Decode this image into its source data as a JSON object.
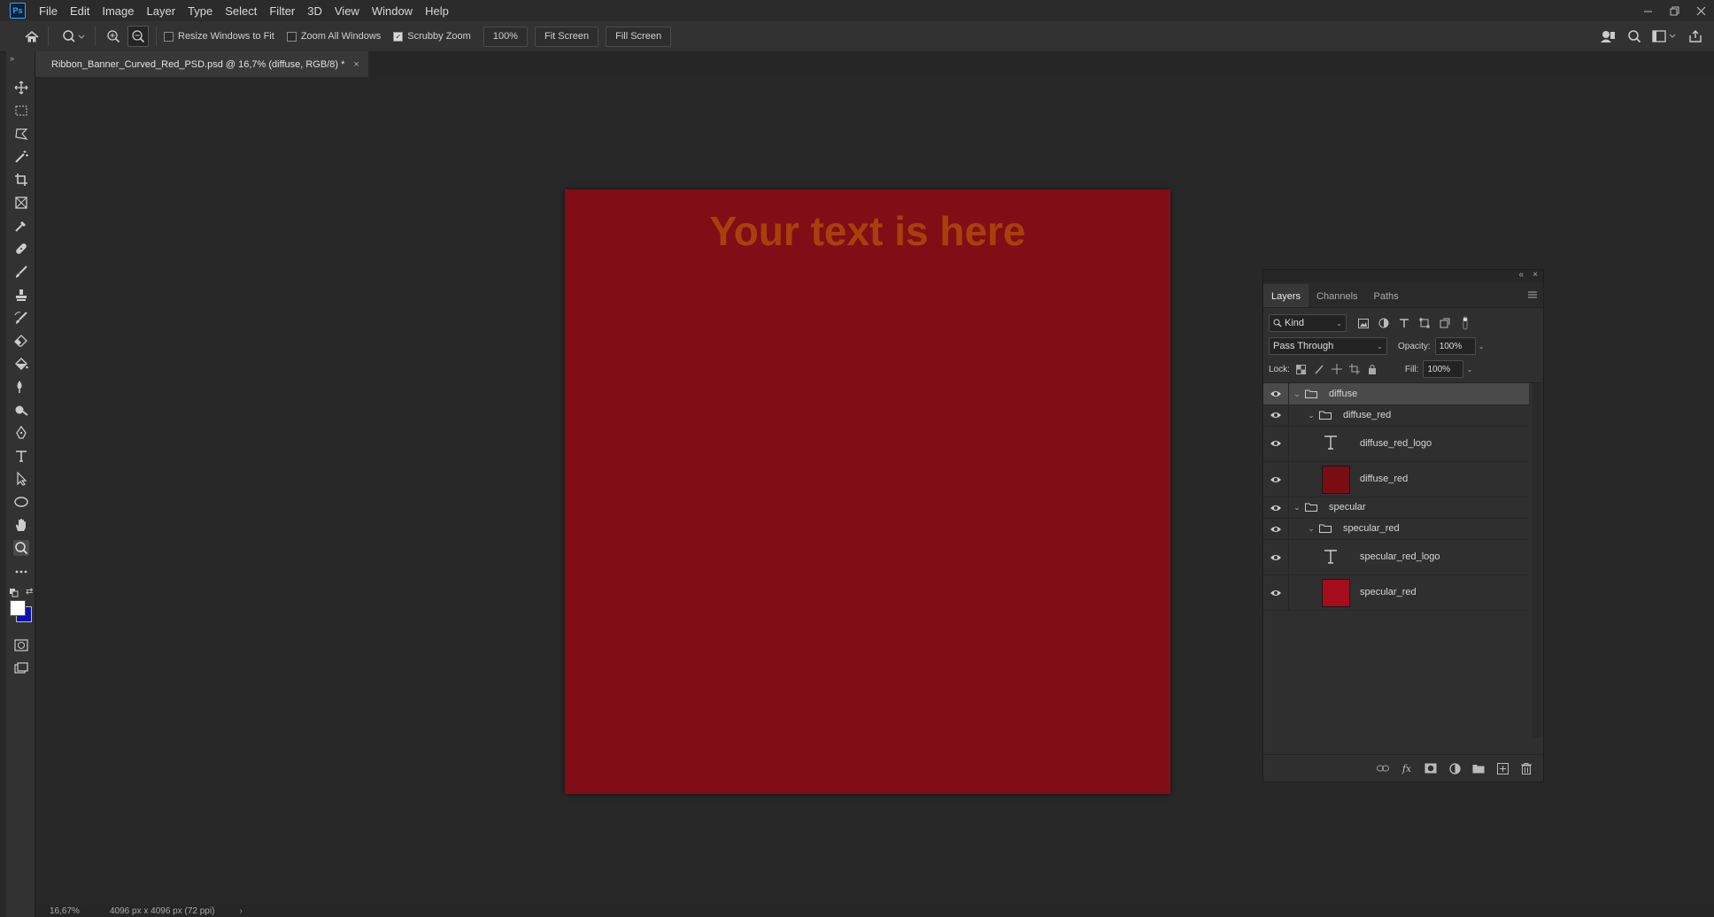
{
  "menu": {
    "logo": "Ps",
    "items": [
      "File",
      "Edit",
      "Image",
      "Layer",
      "Type",
      "Select",
      "Filter",
      "3D",
      "View",
      "Window",
      "Help"
    ]
  },
  "options": {
    "resize_windows": "Resize Windows to Fit",
    "resize_windows_checked": false,
    "zoom_all": "Zoom All Windows",
    "zoom_all_checked": false,
    "scrubby_zoom": "Scrubby Zoom",
    "scrubby_zoom_checked": true,
    "zoom_value": "100%",
    "fit_screen": "Fit Screen",
    "fill_screen": "Fill Screen"
  },
  "document": {
    "tab_title": "Ribbon_Banner_Curved_Red_PSD.psd @ 16,7% (diffuse, RGB/8) *",
    "canvas_text": "Your text is here",
    "canvas_color": "#810d16",
    "text_color": "#a8400c"
  },
  "status": {
    "zoom": "16,67%",
    "doc_size": "4096 px x 4096 px (72 ppi)"
  },
  "layers_panel": {
    "tabs": [
      "Layers",
      "Channels",
      "Paths"
    ],
    "filter_kind": "Kind",
    "blend_mode": "Pass Through",
    "opacity_label": "Opacity:",
    "opacity_value": "100%",
    "lock_label": "Lock:",
    "fill_label": "Fill:",
    "fill_value": "100%",
    "layers": [
      {
        "name": "diffuse",
        "kind": "group",
        "level": 0,
        "selected": true
      },
      {
        "name": "diffuse_red",
        "kind": "group",
        "level": 1
      },
      {
        "name": "diffuse_red_logo",
        "kind": "text",
        "level": 2
      },
      {
        "name": "diffuse_red",
        "kind": "fill",
        "level": 2,
        "swatch": "#7a0c14"
      },
      {
        "name": "specular",
        "kind": "group",
        "level": 0
      },
      {
        "name": "specular_red",
        "kind": "group",
        "level": 1
      },
      {
        "name": "specular_red_logo",
        "kind": "text",
        "level": 2
      },
      {
        "name": "specular_red",
        "kind": "fill",
        "level": 2,
        "swatch": "#a50d1c"
      }
    ]
  },
  "colors": {
    "foreground": "#ffffff",
    "background": "#0a14a8"
  }
}
